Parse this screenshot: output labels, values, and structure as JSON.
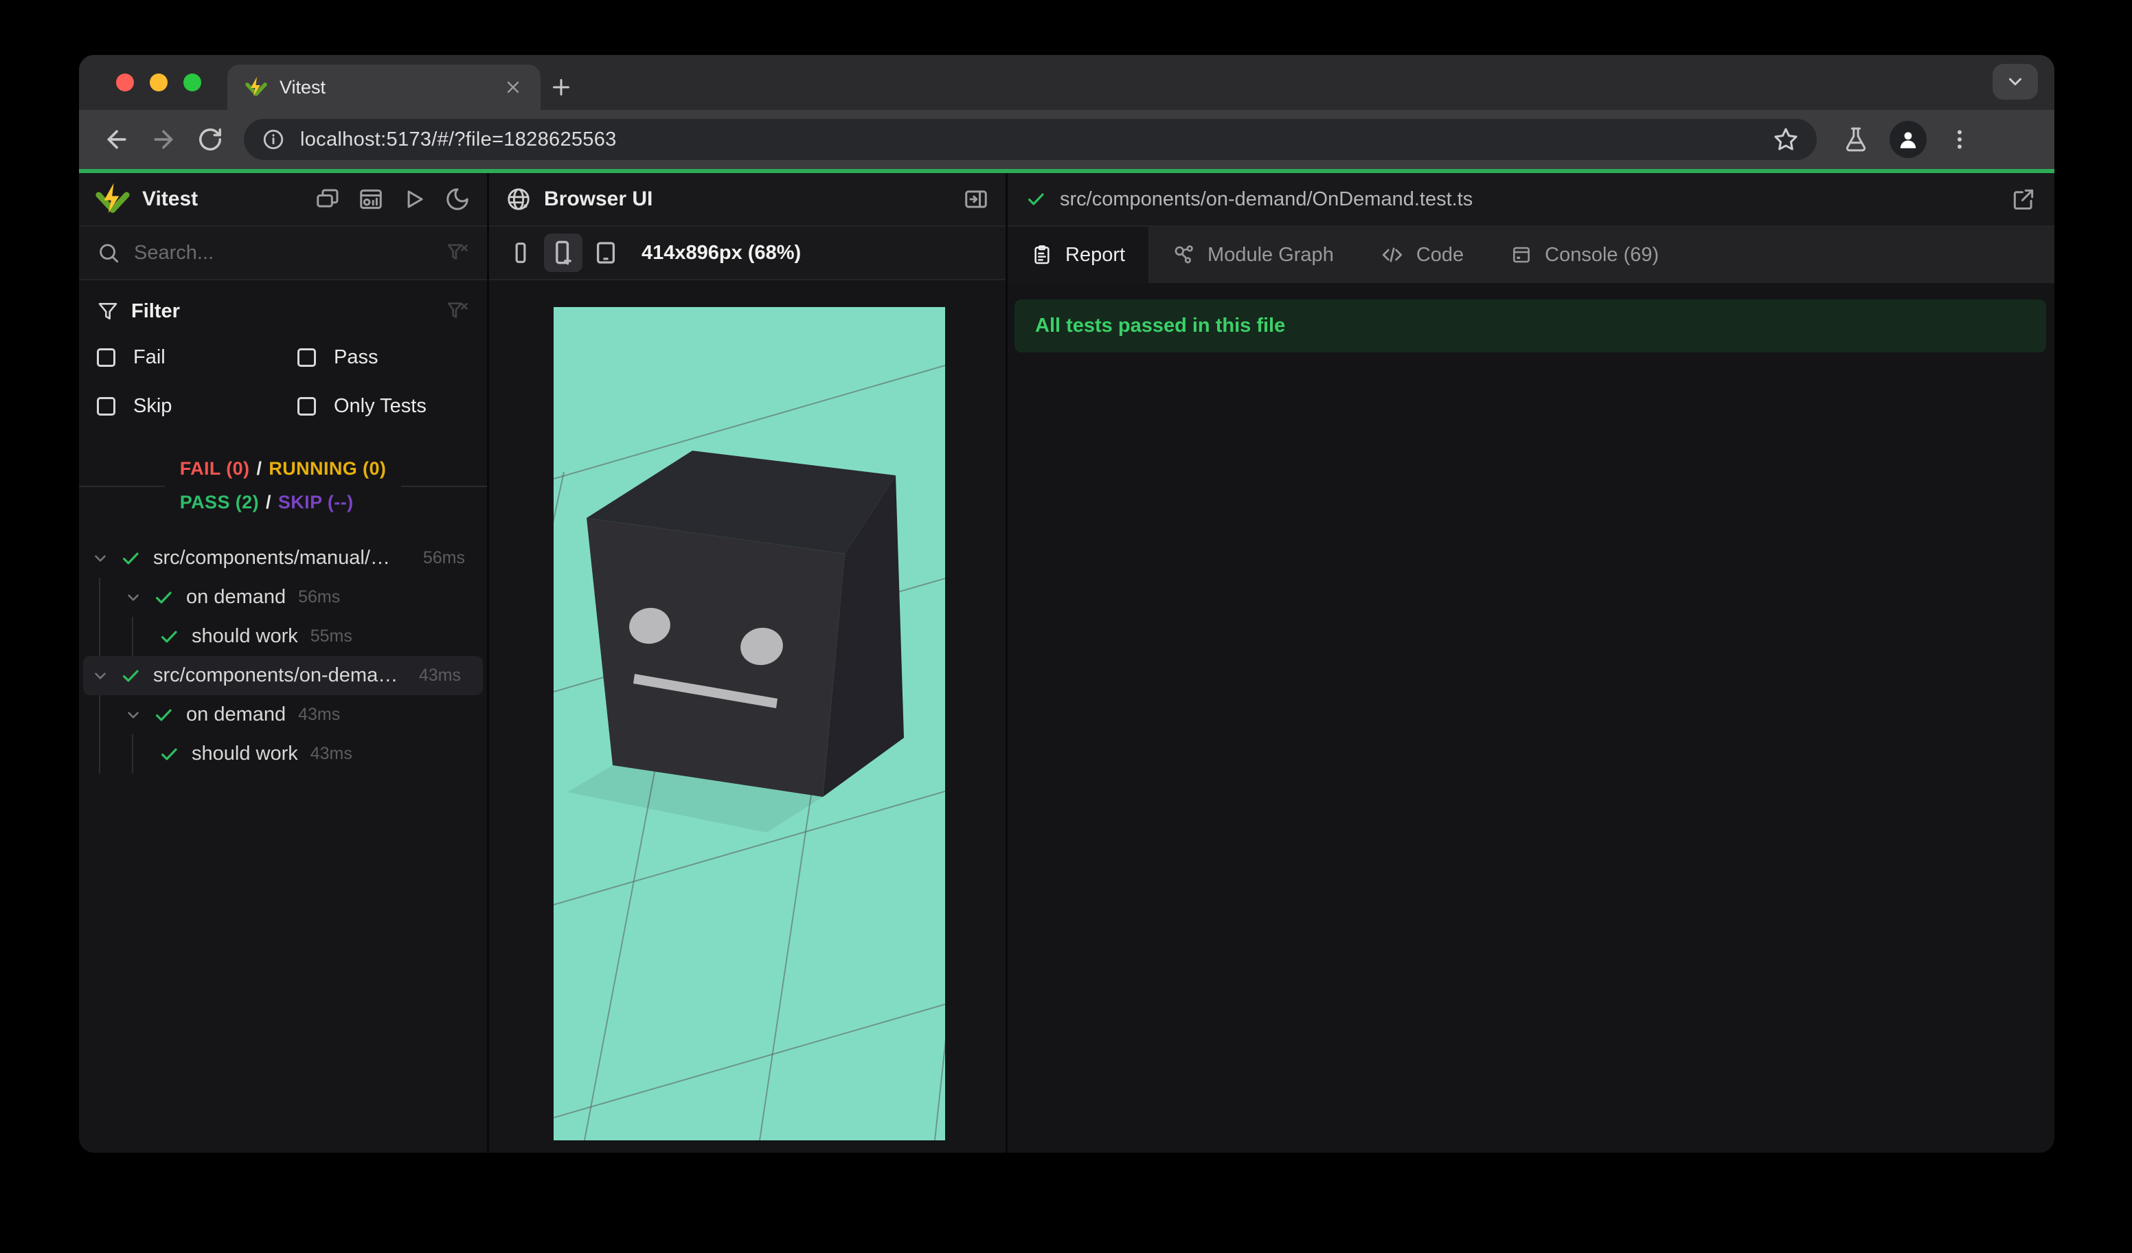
{
  "browser": {
    "tab_title": "Vitest",
    "url": "localhost:5173/#/?file=1828625563"
  },
  "vitest_panel": {
    "title": "Vitest",
    "search_placeholder": "Search...",
    "filter_title": "Filter",
    "filter_options": [
      "Fail",
      "Pass",
      "Skip",
      "Only Tests"
    ],
    "status": {
      "fail": "FAIL (0)",
      "running": "RUNNING (0)",
      "pass": "PASS (2)",
      "skip": "SKIP (--)",
      "separator": "/"
    },
    "tree": [
      {
        "label": "src/components/manual/…",
        "duration": "56ms"
      },
      {
        "label": "on demand",
        "duration": "56ms"
      },
      {
        "label": "should work",
        "duration": "55ms"
      },
      {
        "label": "src/components/on-dema…",
        "duration": "43ms"
      },
      {
        "label": "on demand",
        "duration": "43ms"
      },
      {
        "label": "should work",
        "duration": "43ms"
      }
    ]
  },
  "browser_ui_panel": {
    "title": "Browser UI",
    "viewport_label": "414x896px (68%)"
  },
  "report_panel": {
    "file_path": "src/components/on-demand/OnDemand.test.ts",
    "tabs": [
      "Report",
      "Module Graph",
      "Code",
      "Console (69)"
    ],
    "banner": "All tests passed in this file"
  },
  "colors": {
    "progress_green": "#2dab56",
    "pass_green": "#2ebd69",
    "fail_red": "#f4544e",
    "running_amber": "#e8b00c",
    "skip_purple": "#7a43c4",
    "viewport_teal": "#82dcc4",
    "banner_green_bg": "#152a1d",
    "banner_green_text": "#3bd068",
    "traffic_red": "#ff5f57",
    "traffic_yellow": "#febc2e",
    "traffic_green": "#28c840"
  }
}
